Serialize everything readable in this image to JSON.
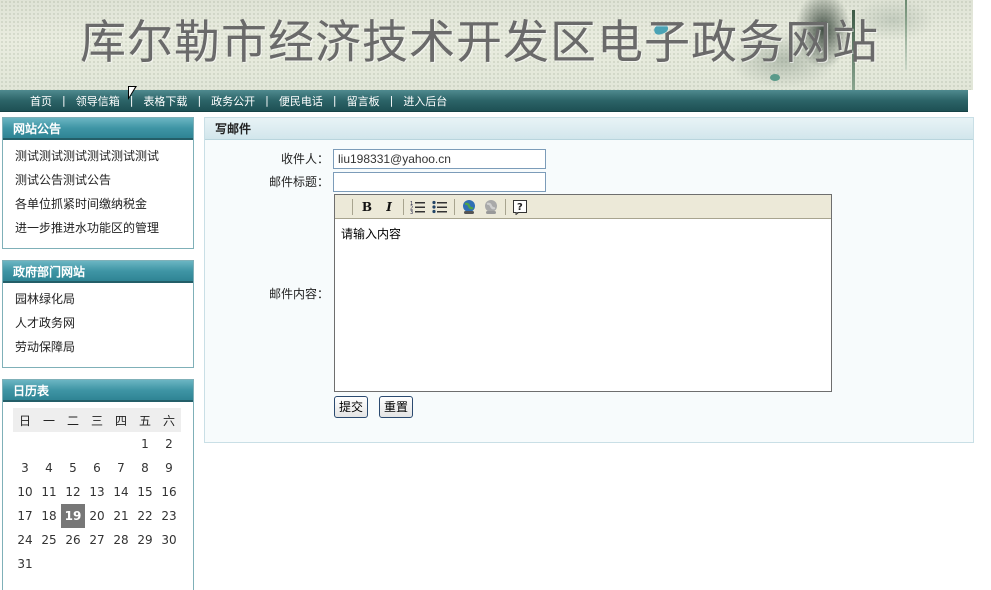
{
  "banner": {
    "title": "库尔勒市经济技术开发区电子政务网站"
  },
  "nav": {
    "items": [
      "首页",
      "领导信箱",
      "表格下载",
      "政务公开",
      "便民电话",
      "留言板",
      "进入后台"
    ],
    "separator": "|"
  },
  "notice": {
    "title": "网站公告",
    "items": [
      "测试测试测试测试测试测试",
      "测试公告测试公告",
      "各单位抓紧时间缴纳税金",
      "进一步推进水功能区的管理"
    ]
  },
  "gov": {
    "title": "政府部门网站",
    "items": [
      "园林绿化局",
      "人才政务网",
      "劳动保障局"
    ]
  },
  "calendar": {
    "title": "日历表",
    "weekdays": [
      "日",
      "一",
      "二",
      "三",
      "四",
      "五",
      "六"
    ],
    "weeks": [
      [
        "",
        "",
        "",
        "",
        "",
        "1",
        "2"
      ],
      [
        "3",
        "4",
        "5",
        "6",
        "7",
        "8",
        "9"
      ],
      [
        "10",
        "11",
        "12",
        "13",
        "14",
        "15",
        "16"
      ],
      [
        "17",
        "18",
        "19",
        "20",
        "21",
        "22",
        "23"
      ],
      [
        "24",
        "25",
        "26",
        "27",
        "28",
        "29",
        "30"
      ],
      [
        "31",
        "",
        "",
        "",
        "",
        "",
        ""
      ]
    ],
    "today": "19"
  },
  "compose": {
    "title": "写邮件",
    "recipient_label": "收件人：",
    "recipient_value": "liu198331@yahoo.cn",
    "subject_label": "邮件标题：",
    "subject_value": "",
    "content_label": "邮件内容：",
    "content_value": "请输入内容",
    "submit_label": "提交",
    "reset_label": "重置"
  },
  "colors": {
    "nav_bar": "#2c6468",
    "panel_header": "#3f95a5",
    "today_bg": "#777777"
  }
}
